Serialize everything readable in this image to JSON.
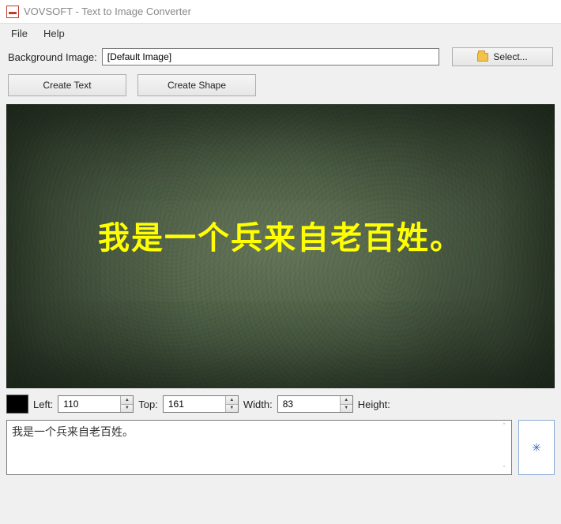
{
  "window": {
    "title": "VOVSOFT - Text to Image Converter"
  },
  "menu": {
    "file": "File",
    "help": "Help"
  },
  "bgImage": {
    "label": "Background Image:",
    "value": "[Default Image]",
    "selectBtn": "Select..."
  },
  "buttons": {
    "createText": "Create Text",
    "createShape": "Create Shape"
  },
  "canvas": {
    "overlayText": "我是一个兵来自老百姓。",
    "textColor": "#ffff00"
  },
  "coords": {
    "leftLabel": "Left:",
    "leftValue": "110",
    "topLabel": "Top:",
    "topValue": "161",
    "widthLabel": "Width:",
    "widthValue": "83",
    "heightLabel": "Height:"
  },
  "textInput": {
    "value": "我是一个兵来自老百姓。"
  },
  "colorSwatch": "#000000"
}
